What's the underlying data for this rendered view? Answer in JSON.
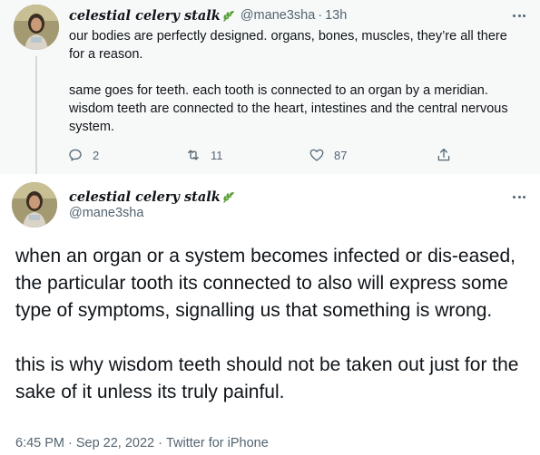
{
  "parent_tweet": {
    "display_name": "celestial celery stalk",
    "name_emoji_icon": "herb-leaf-icon",
    "handle": "@mane3sha",
    "separator": "·",
    "time": "13h",
    "paragraphs": [
      "our bodies are perfectly designed. organs, bones, muscles, they’re all there for a reason.",
      "same goes for teeth. each tooth is connected to an organ by a meridian. wisdom teeth are connected to the heart, intestines and the central nervous system."
    ],
    "actions": {
      "reply_count": "2",
      "retweet_count": "11",
      "like_count": "87"
    }
  },
  "main_tweet": {
    "display_name": "celestial celery stalk",
    "name_emoji_icon": "herb-leaf-icon",
    "handle": "@mane3sha",
    "paragraphs": [
      "when an organ or a system becomes infected or dis-eased, the particular tooth its connected to also will express some type of symptoms, signalling us that something is wrong.",
      "this is why wisdom teeth should not be taken out just for the sake of it unless its truly painful."
    ],
    "meta": {
      "time": "6:45 PM",
      "separator": "·",
      "date": "Sep 22, 2022",
      "source": "Twitter for iPhone"
    }
  },
  "colors": {
    "text_primary": "#0f1419",
    "text_secondary": "#536471",
    "parent_background": "#f7f9f9",
    "thread_line": "#cfd9de",
    "leaf_green": "#5a9e3a"
  }
}
